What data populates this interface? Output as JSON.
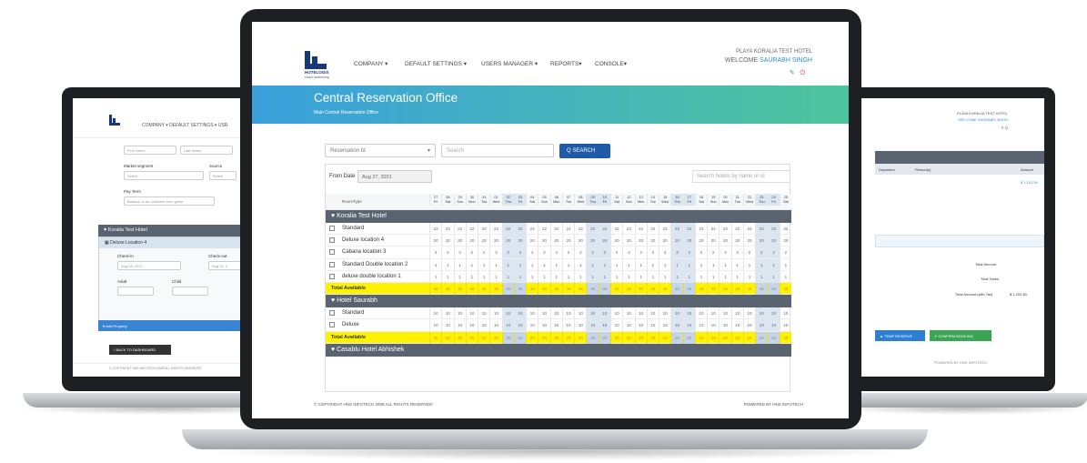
{
  "center": {
    "nav": [
      "COMPANY ▾",
      "DEFAULT SETTINGS ▾",
      "USERS MANAGER ▾",
      "REPORTS▾",
      "CONSOLE▾"
    ],
    "logo_text": "HOTELOGIX",
    "logo_sub": "smart hotelliering",
    "hotel_name": "PLAYA KORALIA TEST HOTEL",
    "welcome_label": "WELCOME",
    "user_name": "SAURABH SINGH",
    "page_title": "Central Reservation Office",
    "breadcrumb": "Main   Central Reservation Office",
    "filter_select": "Reservation Id",
    "search_placeholder": "Search",
    "search_button": "Q  SEARCH",
    "from_date_label": "From Date",
    "from_date_value": "Aug 27, 2021",
    "hotel_search_placeholder": "Search hotels by name or id",
    "room_type_header": "RoomType",
    "dates": [
      "27",
      "28",
      "29",
      "30",
      "31",
      "01",
      "02",
      "03",
      "04",
      "05",
      "06",
      "07",
      "08",
      "09",
      "10",
      "11",
      "12",
      "13",
      "14",
      "15",
      "16",
      "17",
      "18",
      "19",
      "20",
      "21",
      "22",
      "23",
      "24",
      "25"
    ],
    "days": [
      "Fri",
      "Sat",
      "Sun",
      "Mon",
      "Tue",
      "Wed",
      "Thu",
      "Fri",
      "Sat",
      "Sun",
      "Mon",
      "Tue",
      "Wed",
      "Thu",
      "Fri",
      "Sat",
      "Sun",
      "Mon",
      "Tue",
      "Wed",
      "Thu",
      "Fri",
      "Sat",
      "Sun",
      "Mon",
      "Tue",
      "Wed",
      "Thu",
      "Fri",
      "Sat"
    ],
    "groups": [
      {
        "name": "♥ Koralia Test Hotel",
        "rows": [
          {
            "name": "Standard",
            "value": "22"
          },
          {
            "name": "Deluxe location 4",
            "value": "20"
          },
          {
            "name": "Cabana location 3",
            "value": "2"
          },
          {
            "name": "Standard Double location 2",
            "value": "1"
          },
          {
            "name": "deluxe double location 1",
            "value": "1"
          }
        ],
        "total_label": "Total Available",
        "total_value": "46"
      },
      {
        "name": "♥ Hotel Saurabh",
        "rows": [
          {
            "name": "Standard",
            "value": "10"
          },
          {
            "name": "Deluxe",
            "value": "10"
          }
        ],
        "total_label": "Total Available",
        "total_value": "20"
      },
      {
        "name": "♥ Casablu Hotel Abhishek",
        "rows": [],
        "total_label": "",
        "total_value": ""
      }
    ],
    "footer_left": "© COPYRIGHT HNS INFOTECH 2008 ALL RIGHTS RESERVED",
    "footer_right": "POWERED BY  HNS INFOTECH"
  },
  "left": {
    "nav": "COMPANY ▾     DEFAULT SETTINGS ▾     USR",
    "first_name": "First Name",
    "last_name": "Last Name",
    "market_segment_label": "Market segment",
    "source_label": "Source",
    "select": "Select",
    "pay_term_label": "Pay Term",
    "pay_term_value": "Balance to be collected from guest",
    "hotel": "♥ Koralia Test Hotel",
    "room_box": "▦ Deluxe Location 4",
    "checkin_label": "Check-in",
    "checkout_label": "Check-out",
    "checkin_value": "Aug 28, 2021",
    "checkout_value": "Aug 31, 2",
    "adult_label": "Adult",
    "child_label": "Child",
    "add_property": "♥ Add Property",
    "back_button": "‹  BACK TO DASHBOARD",
    "footer": "© COPYRIGHT HNS INFOTECH 2008 ALL RIGHTS RESERVED"
  },
  "right": {
    "hotel_name": "PLAYA KORALIA TEST HOTEL",
    "welcome": "WELCOME SAURABH SINGH",
    "col_departure": "Departure",
    "col_persons": "Person(s)",
    "col_amount": "Amount",
    "amount_1": "$ 1,102.50",
    "total_amount": "Total Amount",
    "total_taxes": "Total Taxes",
    "total_with_tax": "Total Amount (with Tax)",
    "total_with_tax_value": "$ 1,202.50",
    "temp_reserve": "▲ TEMP RESERVE",
    "confirm_booking": "✔ CONFIRM BOOKING",
    "footer": "POWERED BY  HNS INFOTECH"
  }
}
